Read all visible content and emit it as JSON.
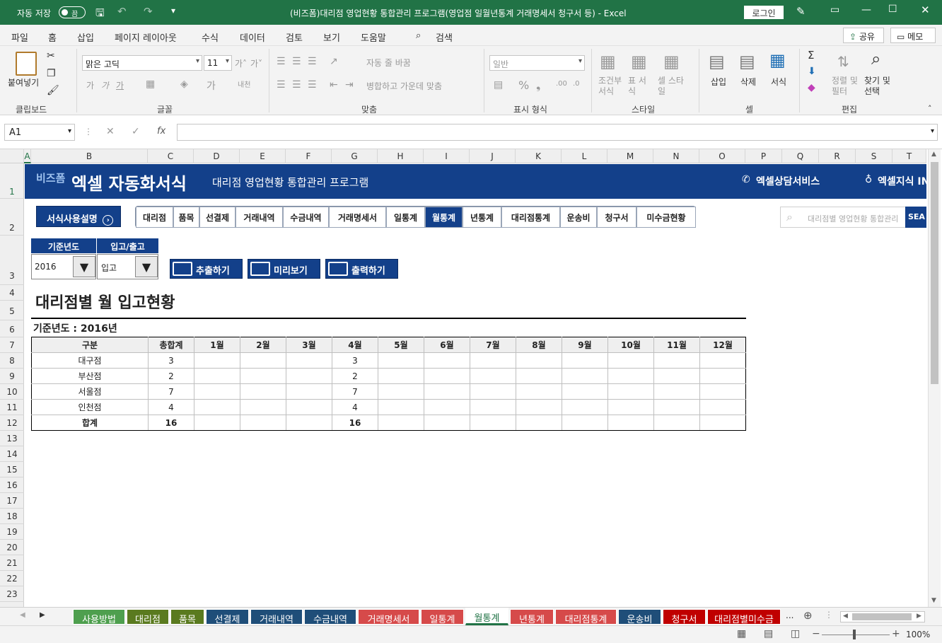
{
  "titlebar": {
    "autosave": "자동 저장",
    "autosave_state": "끔",
    "title": "(비즈폼)대리점 영업현황 통합관리 프로그램(영업점 일월년통계 거래명세서 청구서 등)  -  Excel",
    "login": "로그인"
  },
  "menu": [
    "파일",
    "홈",
    "삽입",
    "페이지 레이아웃",
    "수식",
    "데이터",
    "검토",
    "보기",
    "도움말",
    "검색"
  ],
  "share": "공유",
  "memo": "메모",
  "ribbon": {
    "paste": "붙여넣기",
    "clipboard": "클립보드",
    "font_name": "맑은 고딕",
    "font_size": "11",
    "font": "글꼴",
    "wrap": "자동 줄 바꿈",
    "merge": "병합하고 가운데 맞춤",
    "align": "맞춤",
    "numfmt": "일반",
    "number": "표시 형식",
    "cond_fmt": "조건부 서식",
    "table_fmt": "표 서식",
    "cell_style": "셀 스타일",
    "style": "스타일",
    "insert": "삽입",
    "delete": "삭제",
    "format": "서식",
    "cells": "셀",
    "sort": "정렬 및 필터",
    "find": "찾기 및 선택",
    "edit": "편집"
  },
  "namebox": "A1",
  "columns": [
    "A",
    "B",
    "C",
    "D",
    "E",
    "F",
    "G",
    "H",
    "I",
    "J",
    "K",
    "L",
    "M",
    "N",
    "O",
    "P",
    "Q",
    "R",
    "S",
    "T"
  ],
  "rows": [
    "1",
    "2",
    "3",
    "4",
    "5",
    "6",
    "7",
    "8",
    "9",
    "10",
    "11",
    "12",
    "13",
    "14",
    "15",
    "16",
    "17",
    "18",
    "19",
    "20",
    "21",
    "22",
    "23"
  ],
  "banner": {
    "logo": "비즈폼",
    "brand": "엑셀 자동화서식",
    "program": "대리점 영업현황 통합관리 프로그램",
    "service": "엑셀상담서비스",
    "knowledge": "엑셀지식 IN"
  },
  "guide_button": "서식사용설명",
  "nav": [
    "대리점",
    "품목",
    "선결제",
    "거래내역",
    "수금내역",
    "거래명세서",
    "일통계",
    "월통계",
    "년통계",
    "대리점통계",
    "운송비",
    "청구서",
    "미수금현황"
  ],
  "active_nav": "월통계",
  "search_placeholder": "대리점별 영업현황 통합관리",
  "search_btn": "SEA",
  "filters": {
    "year_label": "기준년도",
    "year_value": "2016",
    "io_label": "입고/출고",
    "io_value": "입고"
  },
  "actions": {
    "extract": "추출하기",
    "preview": "미리보기",
    "print": "출력하기"
  },
  "report": {
    "title": "대리점별 월 입고현황",
    "subtitle": "기준년도 : 2016년",
    "headers": [
      "구분",
      "총합계",
      "1월",
      "2월",
      "3월",
      "4월",
      "5월",
      "6월",
      "7월",
      "8월",
      "9월",
      "10월",
      "11월",
      "12월"
    ],
    "rows": [
      [
        "대구점",
        "3",
        "",
        "",
        "",
        "3",
        "",
        "",
        "",
        "",
        "",
        "",
        "",
        ""
      ],
      [
        "부산점",
        "2",
        "",
        "",
        "",
        "2",
        "",
        "",
        "",
        "",
        "",
        "",
        "",
        ""
      ],
      [
        "서울점",
        "7",
        "",
        "",
        "",
        "7",
        "",
        "",
        "",
        "",
        "",
        "",
        "",
        ""
      ],
      [
        "인천점",
        "4",
        "",
        "",
        "",
        "4",
        "",
        "",
        "",
        "",
        "",
        "",
        "",
        ""
      ]
    ],
    "total": [
      "합계",
      "16",
      "",
      "",
      "",
      "16",
      "",
      "",
      "",
      "",
      "",
      "",
      "",
      ""
    ]
  },
  "sheet_tabs": [
    {
      "label": "사용방법",
      "color": "#4e9f4e"
    },
    {
      "label": "대리점",
      "color": "#5a7a1f"
    },
    {
      "label": "품목",
      "color": "#5a7a1f"
    },
    {
      "label": "선결제",
      "color": "#1f4e79"
    },
    {
      "label": "거래내역",
      "color": "#1f4e79"
    },
    {
      "label": "수금내역",
      "color": "#1f4e79"
    },
    {
      "label": "거래명세서",
      "color": "#d64a4a"
    },
    {
      "label": "일통계",
      "color": "#d64a4a"
    },
    {
      "label": "월통계",
      "color": "#ffffff"
    },
    {
      "label": "년통계",
      "color": "#d64a4a"
    },
    {
      "label": "대리점통계",
      "color": "#d64a4a"
    },
    {
      "label": "운송비",
      "color": "#1f4e79"
    },
    {
      "label": "청구서",
      "color": "#c00000"
    },
    {
      "label": "대리점별미수금",
      "color": "#c00000"
    }
  ],
  "tabs_more": "...",
  "zoom": "100%"
}
